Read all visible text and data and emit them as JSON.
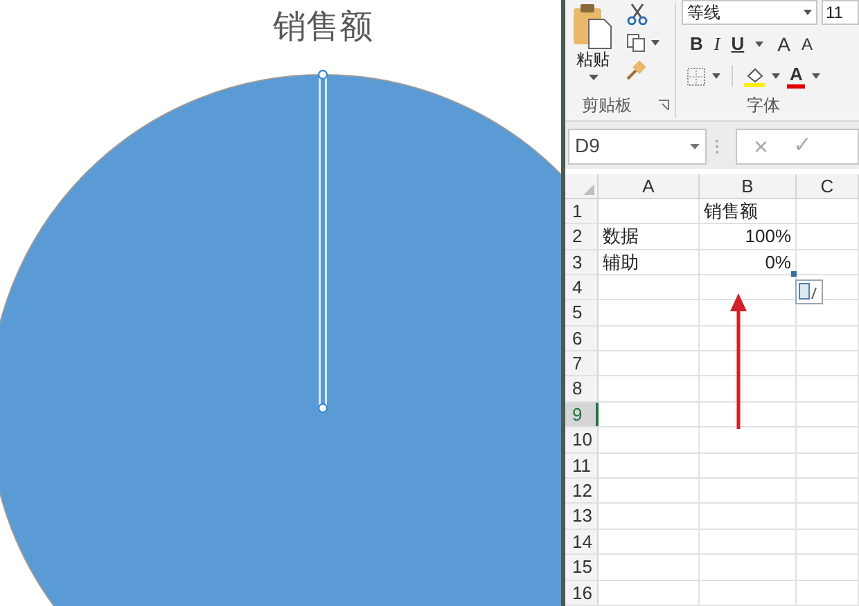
{
  "chart": {
    "title": "销售额",
    "slice_selected": true
  },
  "ribbon": {
    "clipboard": {
      "paste_label": "粘贴",
      "group_label": "剪贴板"
    },
    "font": {
      "font_name": "等线",
      "font_size": "11",
      "bold": "B",
      "italic": "I",
      "underline": "U",
      "grow_font": "A",
      "shrink_font": "A",
      "font_color": "A",
      "group_label": "字体"
    }
  },
  "formula_bar": {
    "name_box": "D9",
    "cancel": "×",
    "enter": "✓"
  },
  "grid": {
    "columns": [
      "A",
      "B",
      "C"
    ],
    "rows": [
      {
        "header": "1",
        "selected": false,
        "col_b": "销售额"
      },
      {
        "header": "2",
        "selected": false,
        "col_a": "数据",
        "col_b": "100%"
      },
      {
        "header": "3",
        "selected": false,
        "col_a": "辅助",
        "col_b": "0%"
      },
      {
        "header": "4",
        "selected": false
      },
      {
        "header": "5",
        "selected": false
      },
      {
        "header": "6",
        "selected": false
      },
      {
        "header": "7",
        "selected": false
      },
      {
        "header": "8",
        "selected": false
      },
      {
        "header": "9",
        "selected": true
      },
      {
        "header": "10",
        "selected": false
      },
      {
        "header": "11",
        "selected": false
      },
      {
        "header": "12",
        "selected": false
      },
      {
        "header": "13",
        "selected": false
      },
      {
        "header": "14",
        "selected": false
      },
      {
        "header": "15",
        "selected": false
      },
      {
        "header": "16",
        "selected": false
      }
    ]
  }
}
